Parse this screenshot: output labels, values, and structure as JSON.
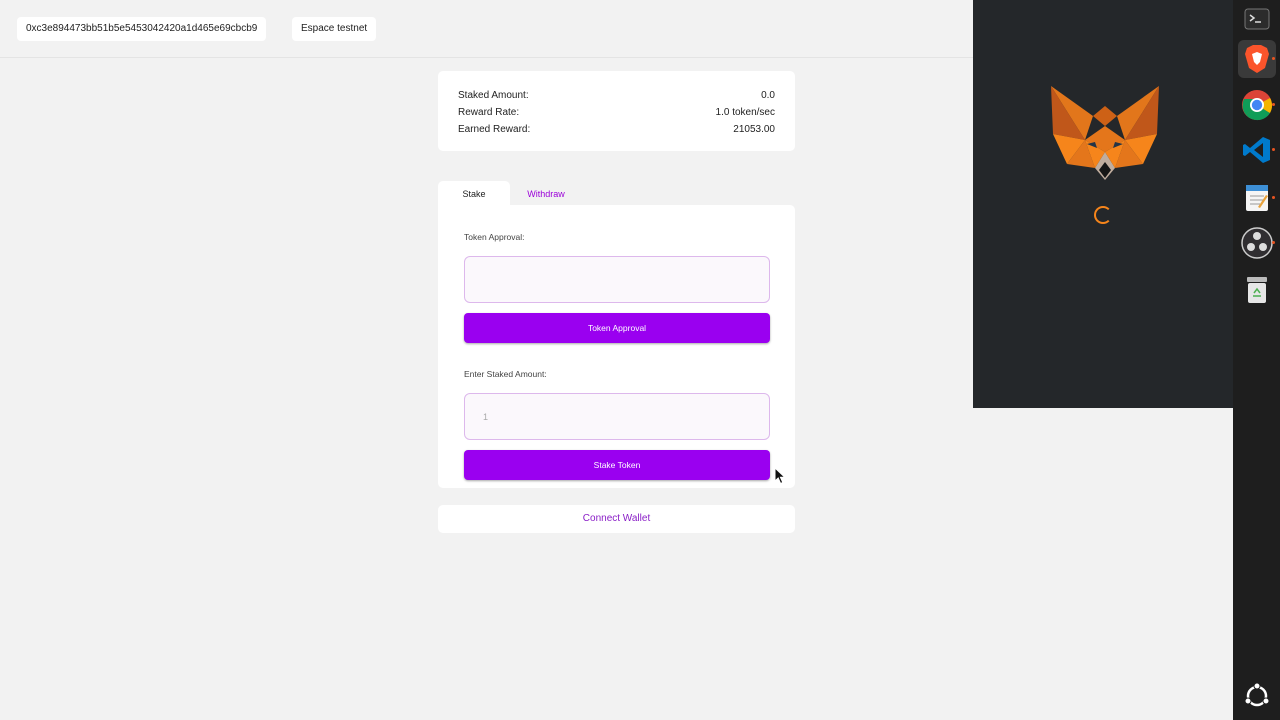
{
  "header": {
    "address": "0xc3e894473bb51b5e5453042420a1d465e69cbcb9",
    "network": "Espace testnet"
  },
  "stats": {
    "staked_label": "Staked Amount:",
    "staked_value": "0.0",
    "rate_label": "Reward Rate:",
    "rate_value": "1.0 token/sec",
    "earned_label": "Earned Reward:",
    "earned_value": "21053.00"
  },
  "tabs": {
    "stake": "Stake",
    "withdraw": "Withdraw"
  },
  "form": {
    "approval_label": "Token Approval:",
    "approval_value": "",
    "approval_button": "Token Approval",
    "stake_label": "Enter Staked Amount:",
    "stake_placeholder": "1",
    "stake_button": "Stake Token"
  },
  "connect_wallet": "Connect Wallet",
  "colors": {
    "accent": "#9a00f0",
    "link": "#9b00d9",
    "metamask_bg": "#24272a",
    "metamask_orange": "#f6851b"
  },
  "icons": {
    "metamask": "fox-icon",
    "loading": "spinner-icon",
    "dock": [
      "terminal-icon",
      "brave-icon",
      "chrome-icon",
      "vscode-icon",
      "text-editor-icon",
      "obs-icon",
      "trash-icon",
      "ubuntu-apps-icon"
    ]
  }
}
